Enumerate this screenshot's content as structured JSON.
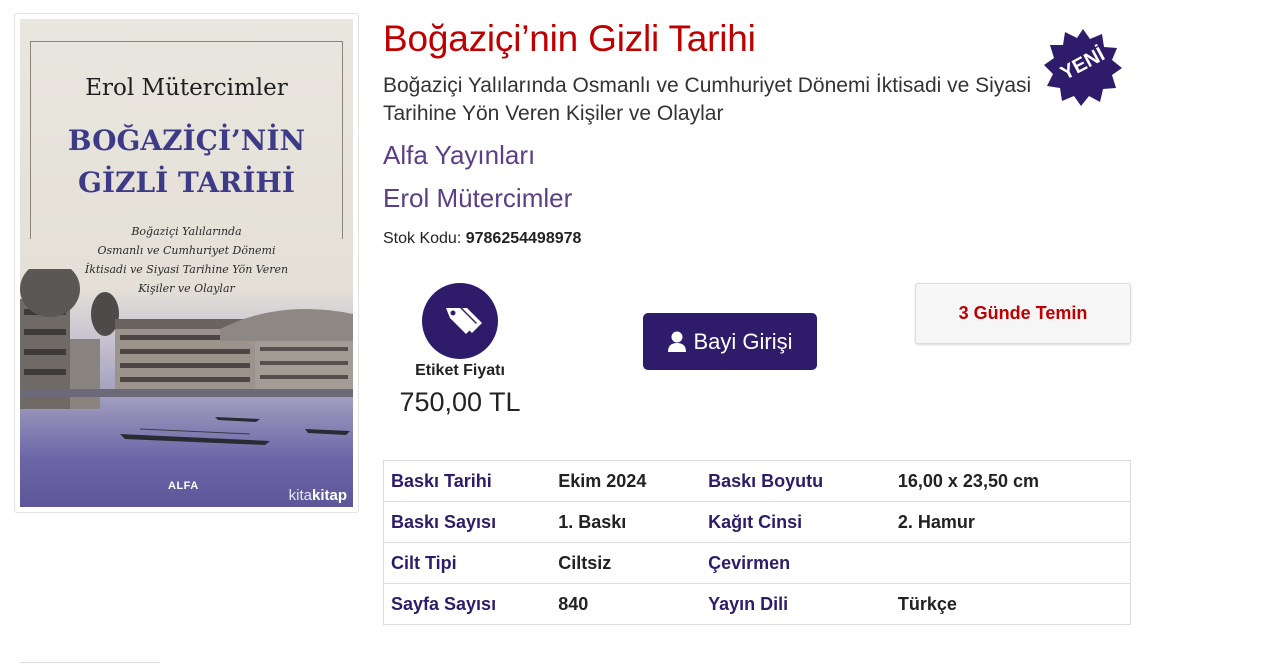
{
  "book": {
    "title": "Boğaziçi’nin Gizli Tarihi",
    "subtitle": "Boğaziçi Yalılarında Osmanlı ve Cumhuriyet Dönemi İktisadi ve Siyasi Tarihine Yön Veren Kişiler ve Olaylar",
    "publisher": "Alfa Yayınları",
    "author": "Erol Mütercimler",
    "stock_label": "Stok Kodu:",
    "stock_code": "9786254498978"
  },
  "cover": {
    "author": "Erol Mütercimler",
    "title_line1": "BOĞAZİÇİ’NİN",
    "title_line2": "GİZLİ TARİHİ",
    "sub_line1": "Boğaziçi Yalılarında",
    "sub_line2": "Osmanlı ve Cumhuriyet Dönemi",
    "sub_line3": "İktisadi ve Siyasi Tarihine Yön Veren",
    "sub_line4": "Kişiler ve Olaylar",
    "publisher": "ALFA",
    "brand_light": "kita",
    "brand_bold": "kitap"
  },
  "badge": {
    "label": "YENİ",
    "color": "#2e1c6a"
  },
  "price": {
    "label": "Etiket Fiyatı",
    "value": "750,00 TL",
    "icon": "price-tag-icon"
  },
  "actions": {
    "dealer_login": "Bayi Girişi",
    "dealer_icon": "user-icon",
    "availability": "3 Günde Temin"
  },
  "specs": [
    {
      "k1": "Baskı Tarihi",
      "v1": "Ekim 2024",
      "k2": "Baskı Boyutu",
      "v2": "16,00 x 23,50 cm"
    },
    {
      "k1": "Baskı Sayısı",
      "v1": "1. Baskı",
      "k2": "Kağıt Cinsi",
      "v2": "2. Hamur"
    },
    {
      "k1": "Cilt Tipi",
      "v1": "Ciltsiz",
      "k2": "Çevirmen",
      "v2": ""
    },
    {
      "k1": "Sayfa Sayısı",
      "v1": "840",
      "k2": "Yayın Dili",
      "v2": "Türkçe"
    }
  ],
  "colors": {
    "title": "#c00000",
    "accent": "#2e1c6a",
    "link": "#5a3f87"
  }
}
